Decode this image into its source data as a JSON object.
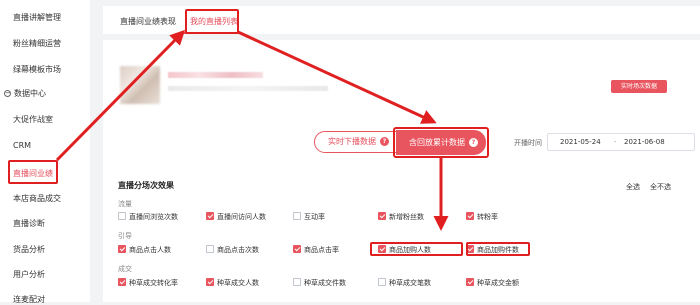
{
  "sidebar": {
    "items": [
      {
        "label": "直播讲解管理"
      },
      {
        "label": "粉丝精细运营"
      },
      {
        "label": "绿幕模板市场"
      },
      {
        "label": "数据中心",
        "group": true
      },
      {
        "label": "大促作战室"
      },
      {
        "label": "CRM"
      },
      {
        "label": "直播间业绩",
        "active": true
      },
      {
        "label": "本店商品成交"
      },
      {
        "label": "直播诊断"
      },
      {
        "label": "货品分析"
      },
      {
        "label": "用户分析"
      },
      {
        "label": "连麦配对"
      }
    ]
  },
  "tabs": [
    {
      "label": "直播间业绩表现",
      "active": false
    },
    {
      "label": "我的直播列表",
      "active": true
    }
  ],
  "header": {
    "realtime_button": "实时场次数据"
  },
  "toggle": {
    "left_label": "实时下播数据",
    "right_label": "含回放累计数据",
    "help_glyph": "?"
  },
  "date_range": {
    "label": "开播时间",
    "start": "2021-05-24",
    "separator": "-",
    "end": "2021-06-08"
  },
  "metrics": {
    "title": "直播分场次效果",
    "select_all": "全选",
    "select_none": "全不选",
    "groups": [
      {
        "name": "流量",
        "options": [
          {
            "label": "直播间浏览次数",
            "checked": false
          },
          {
            "label": "直播间访问人数",
            "checked": true
          },
          {
            "label": "互动率",
            "checked": false
          },
          {
            "label": "新增粉丝数",
            "checked": true
          },
          {
            "label": "转粉率",
            "checked": true
          }
        ]
      },
      {
        "name": "引导",
        "options": [
          {
            "label": "商品点击人数",
            "checked": true
          },
          {
            "label": "商品点击次数",
            "checked": false
          },
          {
            "label": "商品点击率",
            "checked": true
          },
          {
            "label": "商品加购人数",
            "checked": true
          },
          {
            "label": "商品加购件数",
            "checked": true
          }
        ]
      },
      {
        "name": "成交",
        "options": [
          {
            "label": "种草成交转化率",
            "checked": true
          },
          {
            "label": "种草成交人数",
            "checked": true
          },
          {
            "label": "种草成交件数",
            "checked": false
          },
          {
            "label": "种草成交笔数",
            "checked": false
          },
          {
            "label": "种草成交金额",
            "checked": true
          }
        ]
      }
    ]
  },
  "colors": {
    "accent": "#e8555f",
    "annotation": "#e02020"
  }
}
